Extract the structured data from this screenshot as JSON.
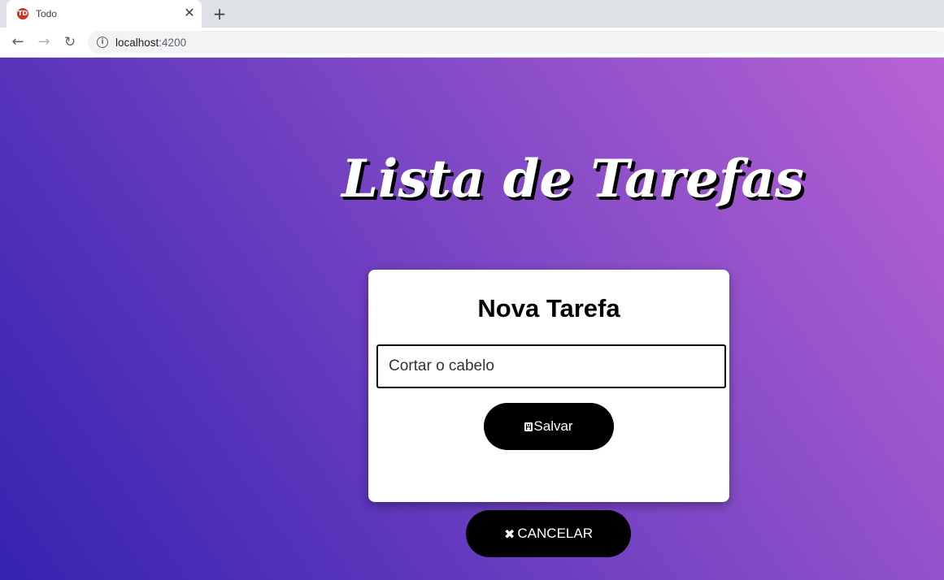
{
  "browser": {
    "tab": {
      "title": "Todo",
      "favicon": "todo-favicon",
      "favicon_text": "TD"
    },
    "url": {
      "host": "localhost",
      "port": ":4200"
    },
    "icons": {
      "back": "←",
      "forward": "→",
      "reload": "↻",
      "close": "✕",
      "new_tab": "+",
      "info": "i"
    }
  },
  "app": {
    "title": "Lista de Tarefas",
    "card": {
      "title": "Nova Tarefa",
      "input_value": "Cortar o cabelo",
      "save_label": "Salvar"
    },
    "cancel_label": "CANCELAR",
    "cancel_icon": "✖"
  },
  "colors": {
    "gradient_start": "#3523b0",
    "gradient_end": "#b862d3",
    "button_bg": "#000000",
    "card_bg": "#ffffff"
  }
}
